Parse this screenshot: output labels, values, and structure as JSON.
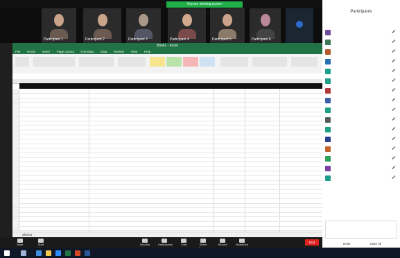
{
  "meeting": {
    "share_tag": "You are viewing screen",
    "participants_tiles": [
      {
        "name": "Participant 1"
      },
      {
        "name": "Participant 2"
      },
      {
        "name": "Participant 3"
      },
      {
        "name": "Participant 4"
      },
      {
        "name": "Participant 5"
      },
      {
        "name": "Participant 6"
      }
    ]
  },
  "excel": {
    "title": "Book1 - Excel",
    "tabs": [
      "File",
      "Home",
      "Insert",
      "Page Layout",
      "Formulas",
      "Data",
      "Review",
      "View",
      "Help"
    ],
    "header_text": "",
    "rows": [
      "",
      "",
      "",
      "",
      "",
      "",
      "",
      "",
      "",
      "",
      "",
      "",
      "",
      "",
      "",
      "",
      "",
      "",
      "",
      "",
      "",
      "",
      "",
      "",
      "",
      "",
      "",
      "",
      "",
      "",
      ""
    ],
    "sheet_tab": "Sheet1"
  },
  "panel": {
    "title": "Participants",
    "participants": [
      {
        "name": "",
        "color": "#6d4c9f"
      },
      {
        "name": "",
        "color": "#3b7a57"
      },
      {
        "name": "",
        "color": "#b25b2a"
      },
      {
        "name": "",
        "color": "#2a6fb2"
      },
      {
        "name": "",
        "color": "#1f9e8a"
      },
      {
        "name": "",
        "color": "#1f9e8a"
      },
      {
        "name": "",
        "color": "#b23a3a"
      },
      {
        "name": "",
        "color": "#3b5fa8"
      },
      {
        "name": "",
        "color": "#1f9e8a"
      },
      {
        "name": "",
        "color": "#5a5a5a"
      },
      {
        "name": "",
        "color": "#1f9e8a"
      },
      {
        "name": "",
        "color": "#2b3f8f"
      },
      {
        "name": "",
        "color": "#c0632a"
      },
      {
        "name": "",
        "color": "#2fa05a"
      },
      {
        "name": "",
        "color": "#7a3fa0"
      },
      {
        "name": "",
        "color": "#1f9e8a"
      }
    ],
    "chat_text": "",
    "invite_label": "Invite",
    "mute_all_label": "Mute All"
  },
  "controls": {
    "items": [
      "Mute",
      "Start Video",
      "Security",
      "Participants",
      "Chat",
      "Share Screen",
      "Record",
      "Reactions"
    ],
    "end_label": "End"
  }
}
